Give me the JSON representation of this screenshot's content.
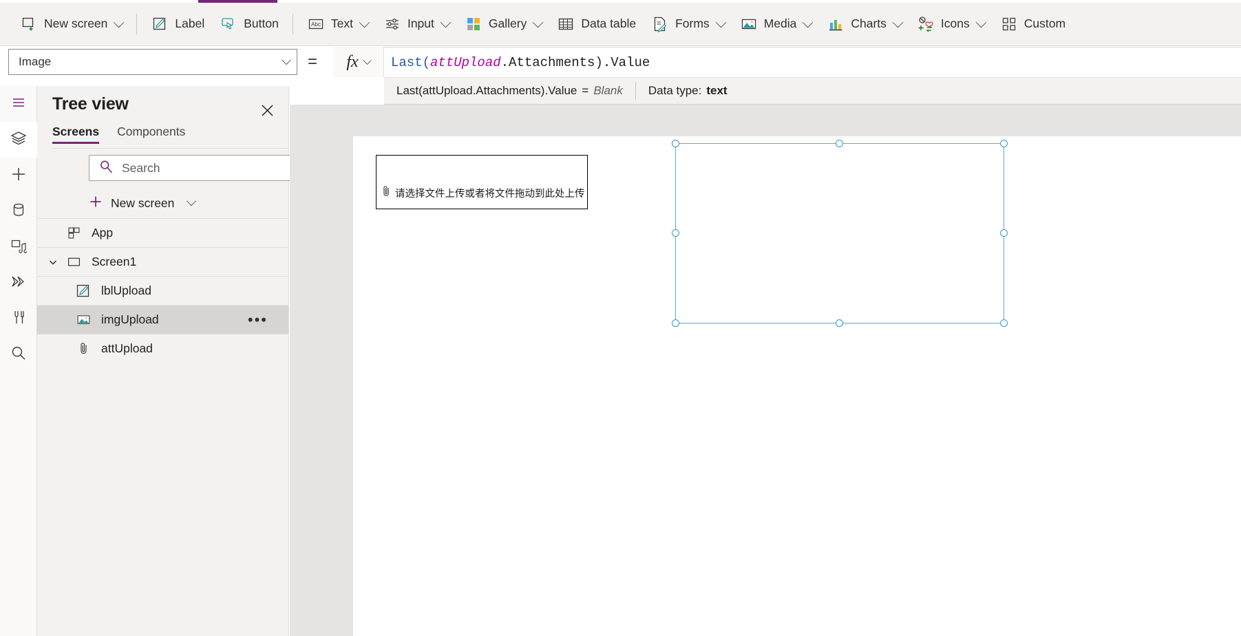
{
  "command_bar": {
    "items": [
      {
        "label": "New screen",
        "icon": "new-screen-icon",
        "has_chevron": true,
        "sep_after": true
      },
      {
        "label": "Label",
        "icon": "label-icon",
        "has_chevron": false,
        "sep_after": false
      },
      {
        "label": "Button",
        "icon": "button-icon",
        "has_chevron": false,
        "sep_after": true
      },
      {
        "label": "Text",
        "icon": "text-abc-icon",
        "has_chevron": true,
        "sep_after": false
      },
      {
        "label": "Input",
        "icon": "input-sliders-icon",
        "has_chevron": true,
        "sep_after": false
      },
      {
        "label": "Gallery",
        "icon": "gallery-icon",
        "has_chevron": true,
        "sep_after": false
      },
      {
        "label": "Data table",
        "icon": "data-table-icon",
        "has_chevron": false,
        "sep_after": false
      },
      {
        "label": "Forms",
        "icon": "forms-icon",
        "has_chevron": true,
        "sep_after": false
      },
      {
        "label": "Media",
        "icon": "media-icon",
        "has_chevron": true,
        "sep_after": false
      },
      {
        "label": "Charts",
        "icon": "charts-icon",
        "has_chevron": true,
        "sep_after": false
      },
      {
        "label": "Icons",
        "icon": "icons-icon",
        "has_chevron": true,
        "sep_after": false
      },
      {
        "label": "Custom",
        "icon": "custom-icon",
        "has_chevron": false,
        "sep_after": false
      }
    ]
  },
  "formula_bar": {
    "property": "Image",
    "equals": "=",
    "fx_label": "fx",
    "formula_tokens": [
      {
        "text": "Last(",
        "kind": "fn"
      },
      {
        "text": "attUpload",
        "kind": "ctrl"
      },
      {
        "text": ".Attachments).Value",
        "kind": "plain"
      }
    ],
    "formula_raw": "Last(attUpload.Attachments).Value"
  },
  "intellisense": {
    "expression": "Last(attUpload.Attachments).Value",
    "equals": "=",
    "result": "Blank",
    "datatype_label": "Data type:",
    "datatype_value": "text"
  },
  "left_rail": {
    "items": [
      {
        "name": "hamburger-menu-icon",
        "active": false
      },
      {
        "name": "tree-view-layers-icon",
        "active": true
      },
      {
        "name": "insert-plus-icon",
        "active": false
      },
      {
        "name": "data-cylinder-icon",
        "active": false
      },
      {
        "name": "media-library-icon",
        "active": false
      },
      {
        "name": "power-automate-flow-icon",
        "active": false
      },
      {
        "name": "variables-tools-icon",
        "active": false
      },
      {
        "name": "search-magnifier-icon",
        "active": false
      }
    ]
  },
  "tree_view": {
    "title": "Tree view",
    "close_icon": "close-icon",
    "tabs": [
      {
        "label": "Screens",
        "active": true
      },
      {
        "label": "Components",
        "active": false
      }
    ],
    "search": {
      "placeholder": "Search",
      "value": "",
      "icon": "search-icon"
    },
    "new_screen": {
      "label": "New screen",
      "icon": "plus-icon",
      "chevron": true
    },
    "items": [
      {
        "label": "App",
        "icon": "app-icon",
        "indent": 0,
        "twisty": "none",
        "selected": false,
        "ellipsis": false
      },
      {
        "label": "Screen1",
        "icon": "screen-icon",
        "indent": 0,
        "twisty": "expanded",
        "selected": false,
        "ellipsis": false
      },
      {
        "label": "lblUpload",
        "icon": "label-icon",
        "indent": 2,
        "twisty": "none",
        "selected": false,
        "ellipsis": false
      },
      {
        "label": "imgUpload",
        "icon": "image-icon",
        "indent": 2,
        "twisty": "none",
        "selected": true,
        "ellipsis": true
      },
      {
        "label": "attUpload",
        "icon": "attach-icon",
        "indent": 2,
        "twisty": "none",
        "selected": false,
        "ellipsis": false
      }
    ],
    "ellipsis_label": "•••"
  },
  "canvas": {
    "attachment_control": {
      "name": "attUpload",
      "text": "请选择文件上传或者将文件拖动到此处上传",
      "icon": "paperclip-icon"
    },
    "image_control": {
      "name": "imgUpload",
      "selected": true,
      "handle_count": 8
    }
  },
  "colors": {
    "accent_purple": "#742774",
    "selection_blue": "#3d92c9",
    "command_bar_bg": "#f3f2f1",
    "panel_bg": "#f3f2f1",
    "canvas_bg": "#e5e4e3",
    "teal_icon": "#2b9b9b",
    "formula_fn_blue": "#2b5797",
    "formula_ctrl_magenta": "#b4009e"
  }
}
